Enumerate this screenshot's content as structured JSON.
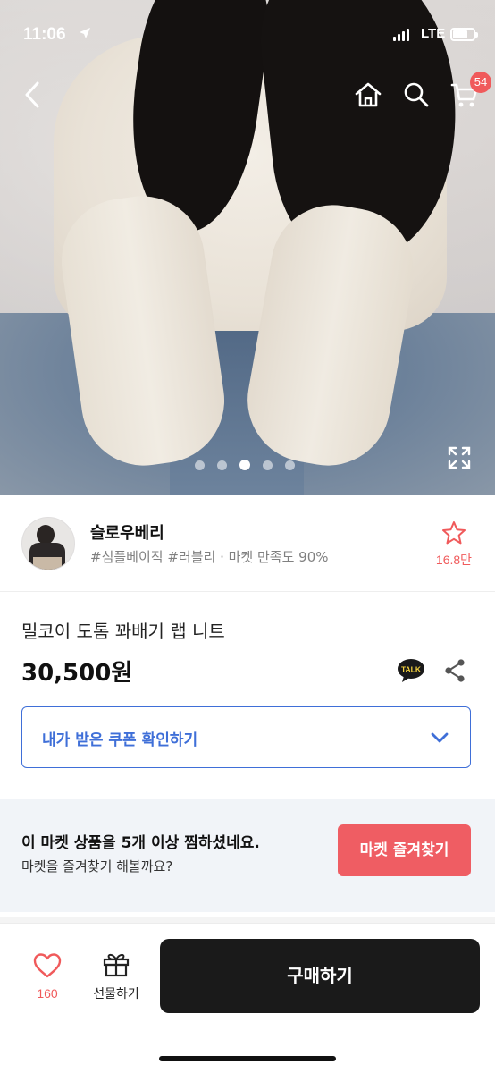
{
  "status_bar": {
    "time": "11:06",
    "network": "LTE",
    "icons": [
      "location-arrow-icon",
      "signal-icon",
      "battery-icon"
    ]
  },
  "nav": {
    "icons": [
      "back-icon",
      "home-icon",
      "search-icon",
      "cart-icon"
    ],
    "cart_badge": "54"
  },
  "gallery": {
    "image_count": 5,
    "active_index": 3,
    "icons": [
      "expand-icon"
    ]
  },
  "seller": {
    "name": "슬로우베리",
    "tags": "#심플베이직 #러블리 · 마켓 만족도 90%",
    "favorite_count": "16.8만",
    "icons": [
      "star-outline-icon"
    ]
  },
  "product": {
    "title": "밀코이 도톰 꽈배기 랩 니트",
    "price": "30,500원",
    "talk_label": "TALK",
    "icons": [
      "kakao-talk-icon",
      "share-icon"
    ]
  },
  "coupon": {
    "label": "내가 받은 쿠폰 확인하기",
    "icons": [
      "chevron-down-icon"
    ]
  },
  "banner": {
    "line1": "이 마켓 상품을 5개 이상 찜하셨네요.",
    "line2": "마켓을 즐겨찾기 해볼까요?",
    "button": "마켓 즐겨찾기"
  },
  "bottom_bar": {
    "like_count": "160",
    "gift_label": "선물하기",
    "buy_label": "구매하기",
    "icons": [
      "heart-outline-icon",
      "gift-icon"
    ]
  },
  "colors": {
    "accent_red": "#f05a5b",
    "coupon_blue": "#3f6fd8",
    "follow_button": "#ef5d63",
    "buy_button": "#1a1a1a",
    "banner_bg": "#f1f4f8"
  }
}
